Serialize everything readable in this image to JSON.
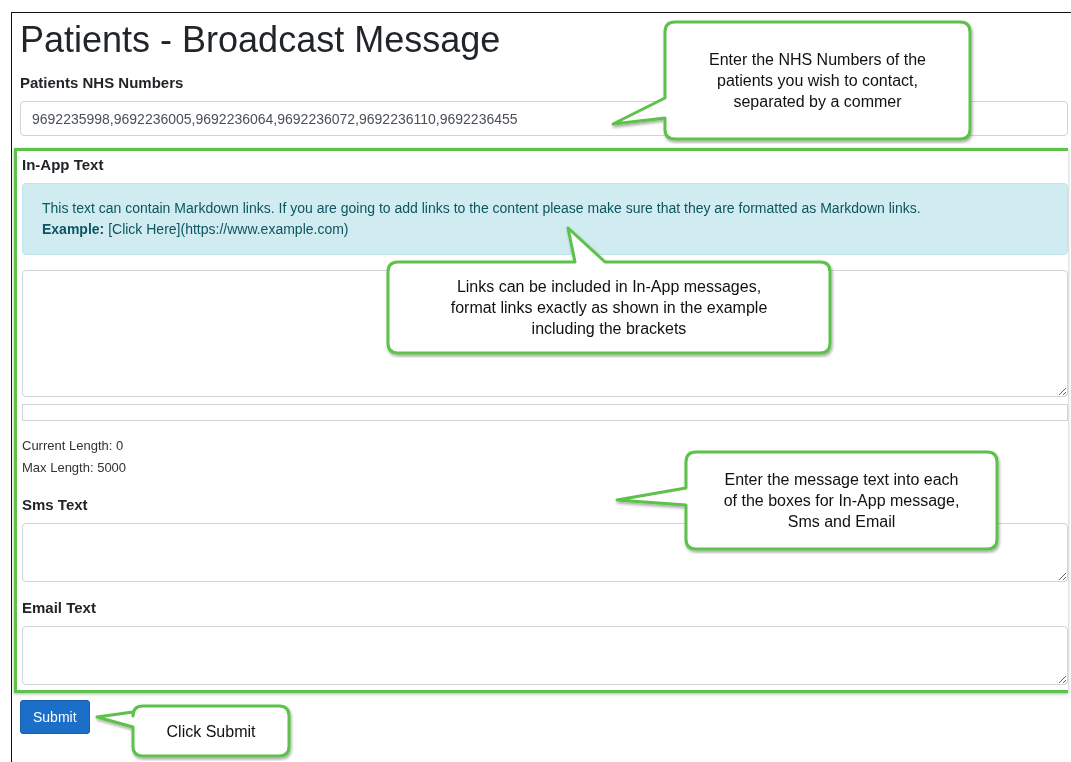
{
  "title": "Patients - Broadcast Message",
  "nhs_numbers": {
    "label": "Patients NHS Numbers",
    "value": "9692235998,9692236005,9692236064,9692236072,9692236110,9692236455"
  },
  "in_app": {
    "label": "In-App Text",
    "info": [
      "This text can contain Markdown links. If you are going to add links to the content please make sure that they are formatted as Markdown links.",
      "**Example:** [Click Here](https://www.example.com)"
    ],
    "current_length": "Current Length: 0",
    "max_length": "Max Length: 5000"
  },
  "sms": {
    "label": "Sms Text"
  },
  "email": {
    "label": "Email Text"
  },
  "submit": "Submit",
  "callouts": [
    {
      "text": "Enter the NHS Numbers of the patients you wish to contact, separated by a commer"
    },
    {
      "text": "Links can be included in In-App messages, format links exactly as shown in the example including the brackets"
    },
    {
      "text": "Enter the message text into each of the boxes for In-App message, Sms and Email"
    },
    {
      "text": "Click Submit"
    }
  ]
}
